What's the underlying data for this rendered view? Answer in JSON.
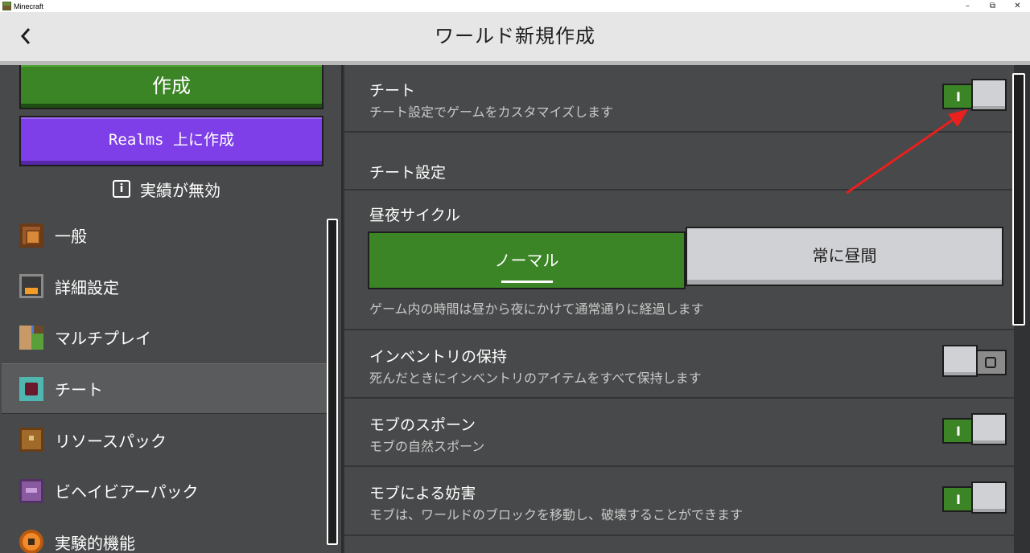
{
  "window": {
    "title": "Minecraft",
    "controls": [
      "–",
      "⧉",
      "✕"
    ]
  },
  "header": {
    "title": "ワールド新規作成",
    "back_icon": "chevron-left-icon"
  },
  "left": {
    "create_label": "作成",
    "realms_label": "Realms 上に作成",
    "achievements_label": "実績が無効",
    "nav": [
      {
        "label": "一般",
        "icon": "general-icon"
      },
      {
        "label": "詳細設定",
        "icon": "advanced-icon"
      },
      {
        "label": "マルチプレイ",
        "icon": "multiplayer-icon"
      },
      {
        "label": "チート",
        "icon": "cheat-icon",
        "active": true
      },
      {
        "label": "リソースパック",
        "icon": "resource-pack-icon"
      },
      {
        "label": "ビヘイビアーパック",
        "icon": "behavior-pack-icon"
      },
      {
        "label": "実験的機能",
        "icon": "experiments-icon"
      }
    ]
  },
  "main": {
    "cheats": {
      "label": "チート",
      "desc": "チート設定でゲームをカスタマイズします",
      "on": true,
      "on_glyph": "I"
    },
    "cheat_settings_heading": "チート設定",
    "day_cycle": {
      "label": "昼夜サイクル",
      "options": [
        "ノーマル",
        "常に昼間"
      ],
      "selected": "ノーマル",
      "desc": "ゲーム内の時間は昼から夜にかけて通常通りに経過します"
    },
    "keep_inventory": {
      "label": "インベントリの保持",
      "desc": "死んだときにインベントリのアイテムをすべて保持します",
      "on": false
    },
    "mob_spawning": {
      "label": "モブのスポーン",
      "desc": "モブの自然スポーン",
      "on": true,
      "on_glyph": "I"
    },
    "mob_griefing": {
      "label": "モブによる妨害",
      "desc": "モブは、ワールドのブロックを移動し、破壊することができます",
      "on": true,
      "on_glyph": "I"
    }
  },
  "annotation": {
    "arrow_color": "#e8201e"
  }
}
